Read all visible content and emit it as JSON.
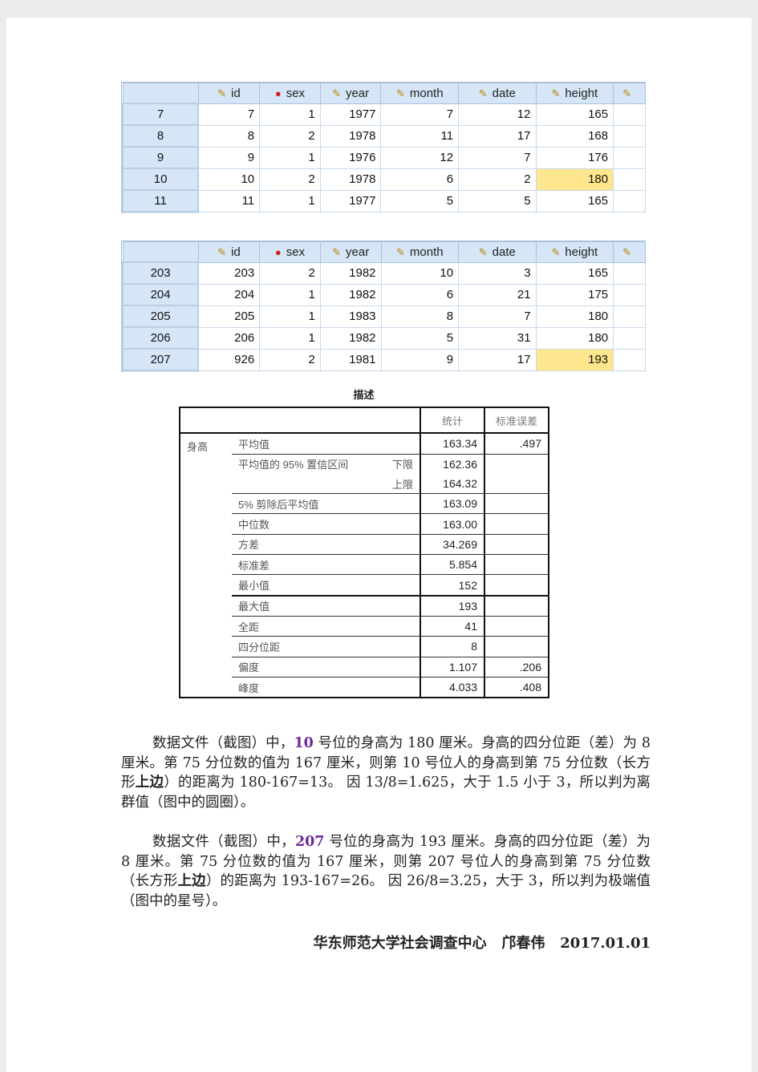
{
  "data_view_1": {
    "columns": [
      {
        "label": "id",
        "icon": "scale-ruler-icon"
      },
      {
        "label": "sex",
        "icon": "nominal-circles-icon"
      },
      {
        "label": "year",
        "icon": "scale-ruler-icon"
      },
      {
        "label": "month",
        "icon": "scale-ruler-icon"
      },
      {
        "label": "date",
        "icon": "scale-ruler-icon"
      },
      {
        "label": "height",
        "icon": "scale-ruler-icon"
      }
    ],
    "rows": [
      {
        "case": "7",
        "values": [
          "7",
          "1",
          "1977",
          "7",
          "12",
          "165"
        ],
        "highlight": false
      },
      {
        "case": "8",
        "values": [
          "8",
          "2",
          "1978",
          "11",
          "17",
          "168"
        ],
        "highlight": false
      },
      {
        "case": "9",
        "values": [
          "9",
          "1",
          "1976",
          "12",
          "7",
          "176"
        ],
        "highlight": false
      },
      {
        "case": "10",
        "values": [
          "10",
          "2",
          "1978",
          "6",
          "2",
          "180"
        ],
        "highlight": true
      },
      {
        "case": "11",
        "values": [
          "11",
          "1",
          "1977",
          "5",
          "5",
          "165"
        ],
        "highlight": false
      }
    ]
  },
  "data_view_2": {
    "columns": [
      {
        "label": "id",
        "icon": "scale-ruler-icon"
      },
      {
        "label": "sex",
        "icon": "nominal-circles-icon"
      },
      {
        "label": "year",
        "icon": "scale-ruler-icon"
      },
      {
        "label": "month",
        "icon": "scale-ruler-icon"
      },
      {
        "label": "date",
        "icon": "scale-ruler-icon"
      },
      {
        "label": "height",
        "icon": "scale-ruler-icon"
      }
    ],
    "rows": [
      {
        "case": "203",
        "values": [
          "203",
          "2",
          "1982",
          "10",
          "3",
          "165"
        ],
        "highlight": false
      },
      {
        "case": "204",
        "values": [
          "204",
          "1",
          "1982",
          "6",
          "21",
          "175"
        ],
        "highlight": false
      },
      {
        "case": "205",
        "values": [
          "205",
          "1",
          "1983",
          "8",
          "7",
          "180"
        ],
        "highlight": false
      },
      {
        "case": "206",
        "values": [
          "206",
          "1",
          "1982",
          "5",
          "31",
          "180"
        ],
        "highlight": false
      },
      {
        "case": "207",
        "values": [
          "926",
          "2",
          "1981",
          "9",
          "17",
          "193"
        ],
        "highlight": true
      }
    ]
  },
  "highlight_color": "#fde68e",
  "descriptives": {
    "title": "描述",
    "headers": {
      "statistic": "统计",
      "std_error": "标准误差"
    },
    "variable": "身高",
    "rows": [
      {
        "label": "平均值",
        "sub": "",
        "value": "163.34",
        "se": ".497",
        "border": "none"
      },
      {
        "label": "平均值的 95% 置信区间",
        "sub": "下限",
        "value": "162.36",
        "se": "",
        "border": "sep"
      },
      {
        "label": "",
        "sub": "上限",
        "value": "164.32",
        "se": "",
        "border": "none"
      },
      {
        "label": "5% 剪除后平均值",
        "sub": "",
        "value": "163.09",
        "se": "",
        "border": "sep"
      },
      {
        "label": "中位数",
        "sub": "",
        "value": "163.00",
        "se": "",
        "border": "sep"
      },
      {
        "label": "方差",
        "sub": "",
        "value": "34.269",
        "se": "",
        "border": "sep"
      },
      {
        "label": "标准差",
        "sub": "",
        "value": "5.854",
        "se": "",
        "border": "sep"
      },
      {
        "label": "最小值",
        "sub": "",
        "value": "152",
        "se": "",
        "border": "sep"
      },
      {
        "label": "最大值",
        "sub": "",
        "value": "193",
        "se": "",
        "border": "thick"
      },
      {
        "label": "全距",
        "sub": "",
        "value": "41",
        "se": "",
        "border": "sep"
      },
      {
        "label": "四分位距",
        "sub": "",
        "value": "8",
        "se": "",
        "border": "sep"
      },
      {
        "label": "偏度",
        "sub": "",
        "value": "1.107",
        "se": ".206",
        "border": "sep"
      },
      {
        "label": "峰度",
        "sub": "",
        "value": "4.033",
        "se": ".408",
        "border": "sep"
      }
    ]
  },
  "paragraphs": [
    {
      "segments": [
        {
          "text": "数据文件（截图）中，",
          "style": ""
        },
        {
          "text": "10",
          "style": "hl"
        },
        {
          "text": " 号位的身高为 180 厘米。身高的四分位距（差）为 8 厘米。第 75 分位数的值为 167 厘米，则第 10 号位人的身高到第 75 分位数（长方形",
          "style": ""
        },
        {
          "text": "上边",
          "style": "b"
        },
        {
          "text": "）的距离为 180-167=13。 因 13/8=1.625，大于 1.5 小于 3，所以判为离群值（图中的圆圈）。",
          "style": ""
        }
      ]
    },
    {
      "segments": [
        {
          "text": "数据文件（截图）中，",
          "style": ""
        },
        {
          "text": "207",
          "style": "hl"
        },
        {
          "text": " 号位的身高为 193 厘米。身高的四分位距（差）为 8 厘米。第 75 分位数的值为 167 厘米，则第 207 号位人的身高到第 75 分位数（长方形",
          "style": ""
        },
        {
          "text": "上边",
          "style": "b"
        },
        {
          "text": "）的距离为 193-167=26。 因 26/8=3.25，大于 3，所以判为极端值（图中的星号）。",
          "style": ""
        }
      ]
    }
  ],
  "footer": {
    "org": "华东师范大学社会调查中心",
    "author": "邝春伟",
    "date": "2017.01.01"
  }
}
